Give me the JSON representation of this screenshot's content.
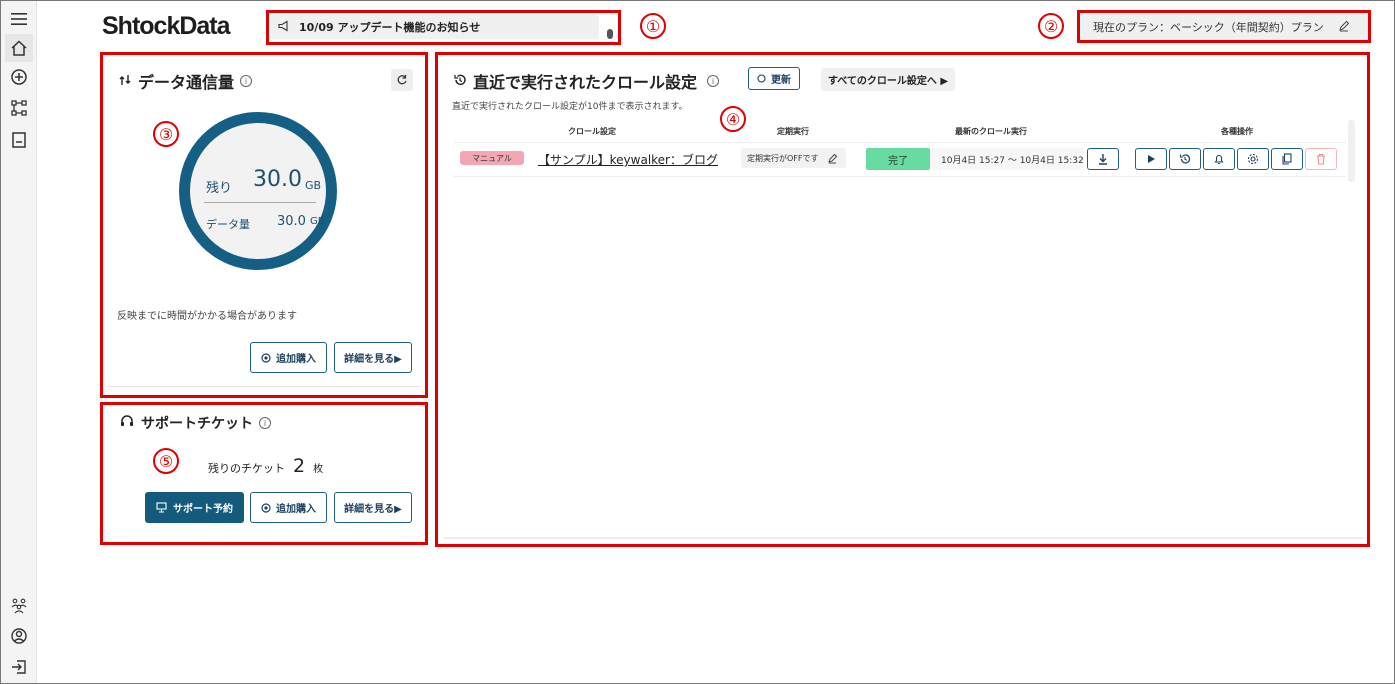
{
  "app": {
    "logo": "ShtockData"
  },
  "notice": {
    "text": "10/09 アップデート機能のお知らせ"
  },
  "plan": {
    "text": "現在のプラン：ベーシック（年間契約）プラン"
  },
  "annotations": [
    "①",
    "②",
    "③",
    "④",
    "⑤"
  ],
  "data_usage": {
    "title": "データ通信量",
    "remaining_label": "残り",
    "remaining_value": "30.0",
    "remaining_unit": "GB",
    "data_label": "データ量",
    "data_value": "30.0",
    "data_unit": "GB",
    "note": "反映までに時間がかかる場合があります",
    "buy_label": "追加購入",
    "detail_label": "詳細を見る▶"
  },
  "support": {
    "title": "サポートチケット",
    "remaining_label": "残りのチケット",
    "remaining_count": "2",
    "remaining_unit": "枚",
    "reserve_label": "サポート予約",
    "buy_label": "追加購入",
    "detail_label": "詳細を見る▶"
  },
  "recent_crawl": {
    "title": "直近で実行されたクロール設定",
    "refresh_label": "更新",
    "all_label": "すべてのクロール設定へ ▶",
    "subtitle": "直近で実行されたクロール設定が10件まで表示されます。",
    "columns": [
      "クロール設定",
      "定期実行",
      "最新のクロール実行",
      "各種操作"
    ],
    "rows": [
      {
        "type": "マニュアル",
        "name": "【サンプル】keywalker：ブログ",
        "schedule": "定期実行がOFFです",
        "status": "完了",
        "range": "10月4日 15:27 ～ 10月4日 15:32"
      }
    ]
  },
  "colors": {
    "accent": "#155f84",
    "annotation": "#e00000",
    "status_done": "#68dba2",
    "manual_badge": "#f3a7b4"
  }
}
